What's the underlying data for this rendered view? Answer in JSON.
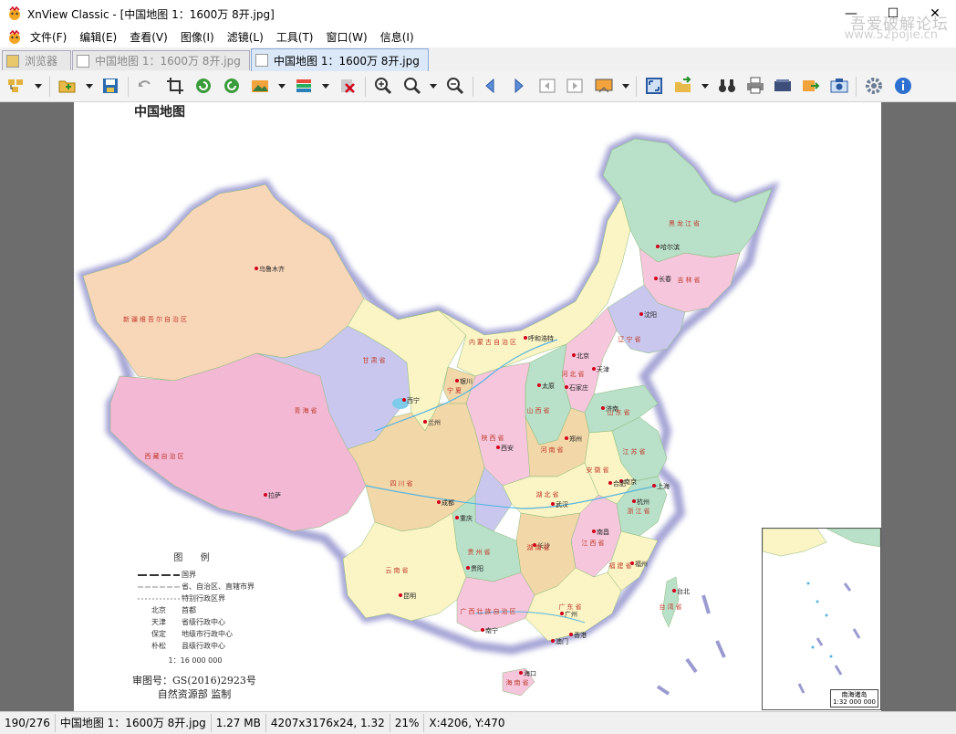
{
  "window": {
    "title": "XnView Classic - [中国地图 1：1600万 8开.jpg]",
    "watermark": "吾爱破解论坛",
    "watermark_url": "www.52pojie.cn"
  },
  "menu": [
    "文件(F)",
    "编辑(E)",
    "查看(V)",
    "图像(I)",
    "滤镜(L)",
    "工具(T)",
    "窗口(W)",
    "信息(I)"
  ],
  "tabs": [
    {
      "label": "浏览器",
      "active": false
    },
    {
      "label": "中国地图 1：1600万 8开.jpg",
      "active": false
    },
    {
      "label": "中国地图 1：1600万 8开.jpg",
      "active": true
    }
  ],
  "toolbar": [
    "browser-icon",
    "open-icon",
    "save-icon",
    "undo-icon",
    "crop-icon",
    "rotate-left-icon",
    "rotate-right-icon",
    "adjust-icon",
    "color-icon",
    "delete-icon",
    "zoom-in-icon",
    "zoom-fit-icon",
    "zoom-out-icon",
    "prev-icon",
    "next-icon",
    "first-icon",
    "last-icon",
    "slideshow-icon",
    "fullscreen-icon",
    "export-icon",
    "binoculars-icon",
    "print-icon",
    "scanner-icon",
    "convert-icon",
    "capture-icon",
    "settings-icon",
    "info-icon"
  ],
  "map": {
    "title": "中国地图",
    "legend_title": "图 例",
    "legend_rows": [
      {
        "label": "国界"
      },
      {
        "label": "省、自治区、直辖市界"
      },
      {
        "label": "特别行政区界"
      },
      {
        "sym": "北京",
        "label": "首都"
      },
      {
        "sym": "天津",
        "label": "省级行政中心"
      },
      {
        "sym": "保定",
        "label": "地级市行政中心"
      },
      {
        "sym": "朴松",
        "label": "县级行政中心"
      }
    ],
    "scale": "1：16 000 000",
    "approval": "审图号：GS(2016)2923号",
    "supervisor": "自然资源部 监制",
    "inset_label": "南海诸岛",
    "inset_scale": "1:32 000 000",
    "cities": [
      "乌鲁木齐",
      "拉萨",
      "西宁",
      "兰州",
      "银川",
      "呼和浩特",
      "北京",
      "天津",
      "石家庄",
      "太原",
      "沈阳",
      "长春",
      "哈尔滨",
      "济南",
      "郑州",
      "西安",
      "成都",
      "重庆",
      "武汉",
      "长沙",
      "南京",
      "上海",
      "杭州",
      "合肥",
      "南昌",
      "福州",
      "台北",
      "广州",
      "南宁",
      "昆明",
      "贵阳",
      "海口",
      "香港",
      "澳门"
    ],
    "regions": [
      "新疆维吾尔自治区",
      "西藏自治区",
      "青海省",
      "甘肃省",
      "内蒙古自治区",
      "黑龙江省",
      "吉林省",
      "辽宁省",
      "河北省",
      "山西省",
      "陕西省",
      "宁夏",
      "四川省",
      "云南省",
      "广西壮族自治区",
      "广东省",
      "湖南省",
      "湖北省",
      "河南省",
      "山东省",
      "江苏省",
      "安徽省",
      "江西省",
      "浙江省",
      "福建省",
      "台湾省",
      "贵州省",
      "海南省"
    ]
  },
  "status": {
    "index": "190/276",
    "filename": "中国地图 1：1600万 8开.jpg",
    "filesize": "1.27 MB",
    "dimensions": "4207x3176x24, 1.32",
    "zoom": "21%",
    "coords": "X:4206, Y:470"
  }
}
